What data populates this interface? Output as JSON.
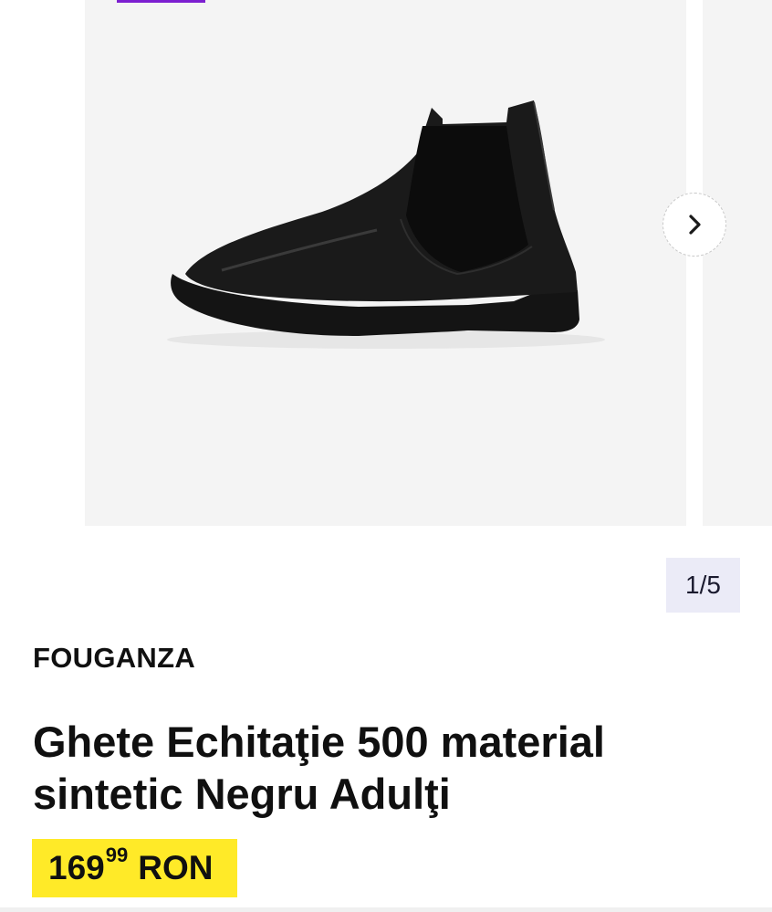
{
  "gallery": {
    "counter": "1/5",
    "image_alt": "Ghete Echitaţie 500 material sintetic Negru Adulţi",
    "next_icon": "chevron-right-icon"
  },
  "product": {
    "brand": "FOUGANZA",
    "title": "Ghete Echitaţie 500 material sintetic Negru Adulţi",
    "price": {
      "integer": "169",
      "decimals": "99",
      "currency": "RON"
    }
  },
  "colors": {
    "image_background": "#f4f4f4",
    "counter_background": "#ebebf7",
    "price_background": "#ffea28",
    "promo_strip": "#7c1fd0"
  }
}
